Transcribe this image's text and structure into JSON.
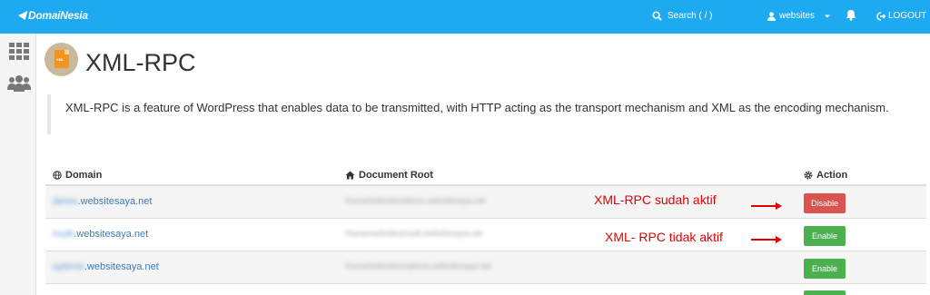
{
  "topbar": {
    "brand": "DomaiNesia",
    "search_label": "Search ( / )",
    "user_label": "websites",
    "logout_label": "LOGOUT"
  },
  "sidebar": {
    "items": [
      {
        "icon": "apps-grid-icon"
      },
      {
        "icon": "users-icon"
      }
    ]
  },
  "page": {
    "title": "XML-RPC",
    "description": "XML-RPC is a feature of WordPress that enables data to be transmitted, with HTTP acting as the transport mechanism and XML as the encoding mechanism."
  },
  "table": {
    "headers": {
      "domain": "Domain",
      "document_root": "Document Root",
      "action": "Action"
    },
    "rows": [
      {
        "subdomain": "demo",
        "domain_suffix": ".websitesaya.net",
        "document_root": "/home/websites/demo.websitesaya.net",
        "action": "Disable",
        "action_color": "#d9534f"
      },
      {
        "subdomain": "multi",
        "domain_suffix": ".websitesaya.net",
        "document_root": "/home/websites/multi.websitesaya.net",
        "action": "Enable",
        "action_color": "#4caf50"
      },
      {
        "subdomain": "optimis",
        "domain_suffix": ".websitesaya.net",
        "document_root": "/home/websites/optimis.websitesaya.net",
        "action": "Enable",
        "action_color": "#4caf50"
      }
    ]
  },
  "annotations": {
    "active": "XML-RPC sudah aktif",
    "inactive": "XML- RPC tidak aktif"
  },
  "colors": {
    "topbar": "#1eaaf1",
    "annotation": "#e10000",
    "link": "#3a7bb8"
  }
}
